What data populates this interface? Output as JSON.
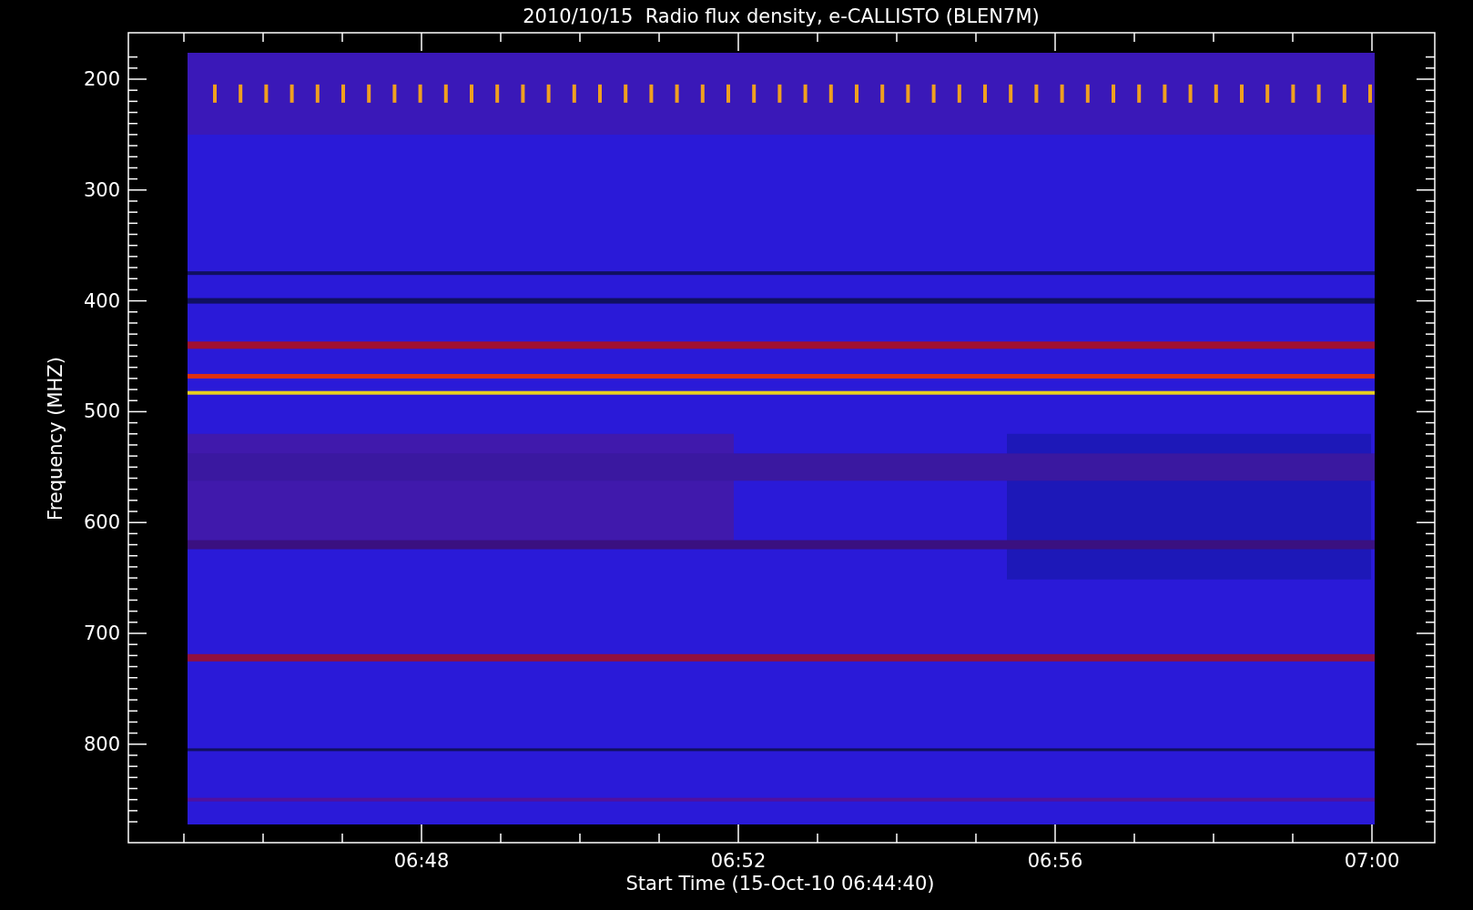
{
  "title": "2010/10/15  Radio flux density, e-CALLISTO (BLEN7M)",
  "y_axis": {
    "label": "Frequency (MHZ)",
    "ticks": [
      "200",
      "300",
      "400",
      "500",
      "600",
      "700",
      "800"
    ]
  },
  "x_axis": {
    "label": "Start Time (15-Oct-10 06:44:40)",
    "ticks": [
      "06:48",
      "06:52",
      "06:56",
      "07:00"
    ]
  }
}
